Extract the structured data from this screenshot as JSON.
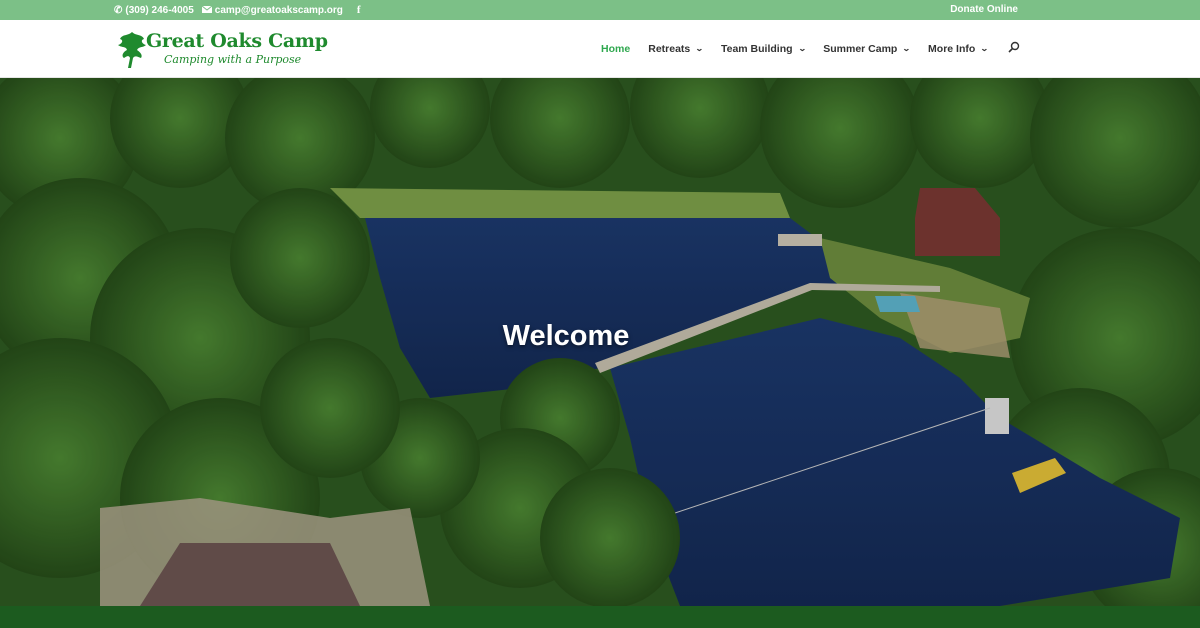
{
  "topbar": {
    "phone": "(309) 246-4005",
    "email": "camp@greatoakscamp.org",
    "social_icon": "facebook-icon",
    "donate_label": "Donate Online"
  },
  "logo": {
    "brand": "Great Oaks Camp",
    "tagline": "Camping with a Purpose"
  },
  "nav": {
    "items": [
      {
        "label": "Home",
        "active": true,
        "dropdown": false
      },
      {
        "label": "Retreats",
        "active": false,
        "dropdown": true
      },
      {
        "label": "Team Building",
        "active": false,
        "dropdown": true
      },
      {
        "label": "Summer Camp",
        "active": false,
        "dropdown": true
      },
      {
        "label": "More Info",
        "active": false,
        "dropdown": true
      }
    ],
    "search_icon": "search-icon"
  },
  "hero": {
    "heading": "Welcome"
  },
  "colors": {
    "topbar": "#7cc087",
    "accent": "#2fa84f",
    "footer": "#1c5b1f"
  }
}
